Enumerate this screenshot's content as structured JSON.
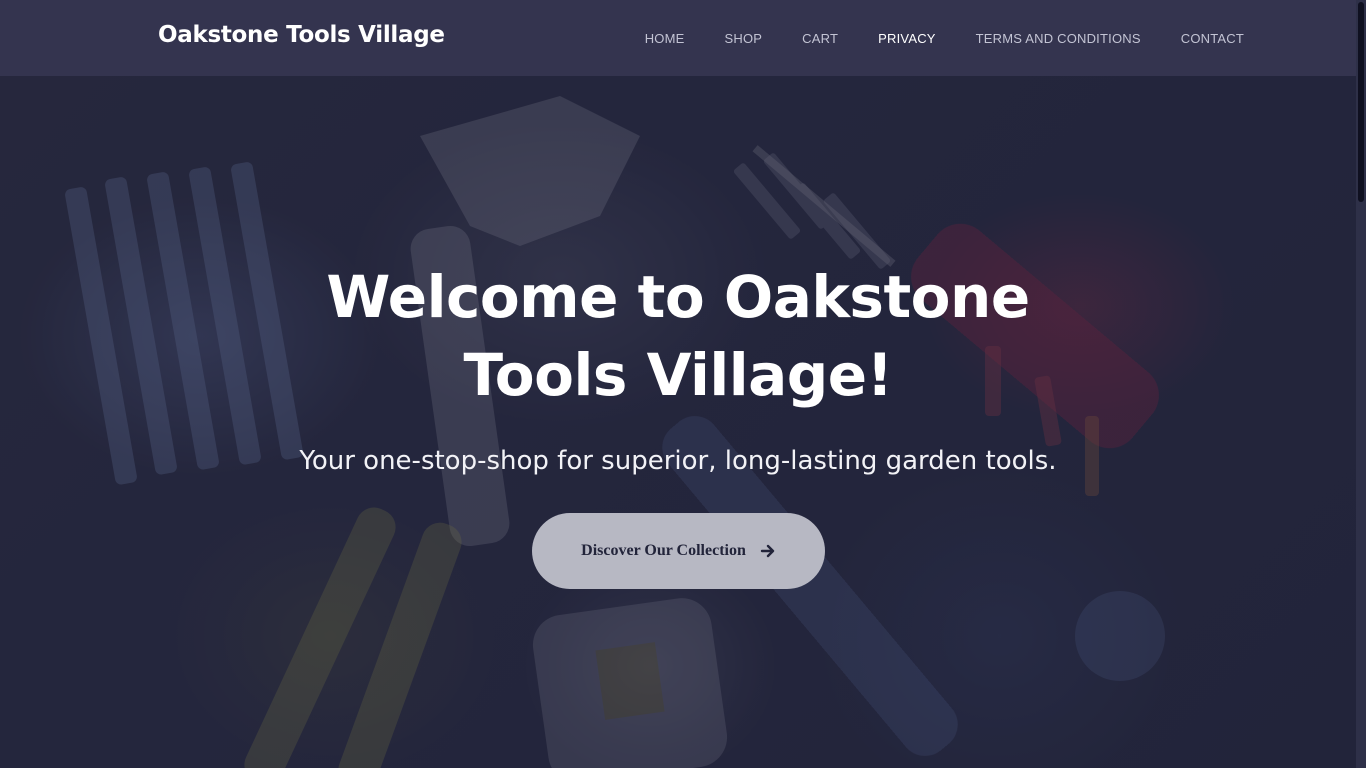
{
  "navbar": {
    "brand": "Oakstone Tools Village",
    "links": [
      {
        "label": "HOME",
        "active": false
      },
      {
        "label": "SHOP",
        "active": false
      },
      {
        "label": "CART",
        "active": false
      },
      {
        "label": "PRIVACY",
        "active": true
      },
      {
        "label": "TERMS AND CONDITIONS",
        "active": false
      },
      {
        "label": "CONTACT",
        "active": false
      }
    ]
  },
  "hero": {
    "title": "Welcome to Oakstone Tools Village!",
    "subtitle": "Your one-stop-shop for superior, long-lasting garden tools.",
    "cta_label": "Discover Our Collection",
    "cta_icon": "arrow-right-icon",
    "background_image": "tools-on-wood-photo"
  },
  "colors": {
    "navbar_bg": "#34344f",
    "overlay": "#22243a",
    "cta_bg": "#b7b8c3",
    "cta_text": "#22243a",
    "active_link": "#ffffff",
    "link": "#c3c4d4"
  }
}
